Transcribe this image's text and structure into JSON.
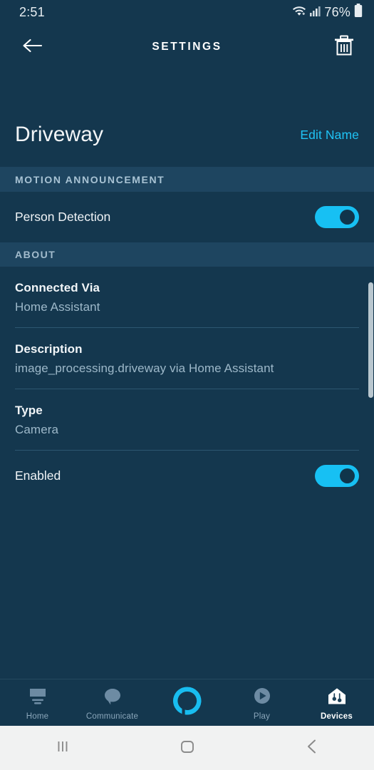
{
  "status_bar": {
    "time": "2:51",
    "battery_percent": "76%",
    "wifi_icon": "wifi-icon",
    "signal_icon": "cellular-signal-icon",
    "battery_icon": "battery-icon"
  },
  "app_bar": {
    "back_icon": "back-arrow-icon",
    "title": "SETTINGS",
    "delete_icon": "trash-icon"
  },
  "device": {
    "name": "Driveway",
    "edit_name_label": "Edit Name"
  },
  "sections": {
    "motion": {
      "header": "MOTION ANNOUNCEMENT",
      "person_detection": {
        "label": "Person Detection",
        "state": "on"
      }
    },
    "about": {
      "header": "ABOUT",
      "items": [
        {
          "key": "Connected Via",
          "value": "Home Assistant"
        },
        {
          "key": "Description",
          "value": "image_processing.driveway via Home Assistant"
        },
        {
          "key": "Type",
          "value": "Camera"
        }
      ],
      "enabled": {
        "label": "Enabled",
        "state": "on"
      }
    }
  },
  "bottom_nav": {
    "items": [
      {
        "label": "Home",
        "icon": "home-icon",
        "active": false
      },
      {
        "label": "Communicate",
        "icon": "speech-bubble-icon",
        "active": false
      },
      {
        "label": "",
        "icon": "alexa-ring-icon",
        "active": false
      },
      {
        "label": "Play",
        "icon": "play-circle-icon",
        "active": false
      },
      {
        "label": "Devices",
        "icon": "devices-house-icon",
        "active": true
      }
    ]
  },
  "system_nav": {
    "recent_apps_icon": "recent-apps-icon",
    "home_icon": "system-home-icon",
    "back_icon": "system-back-icon"
  },
  "colors": {
    "background": "#14374e",
    "section_band": "#1e4560",
    "accent_cyan": "#17c0f3",
    "link_cyan": "#1fc3f5",
    "muted_text": "#9db8c9"
  }
}
